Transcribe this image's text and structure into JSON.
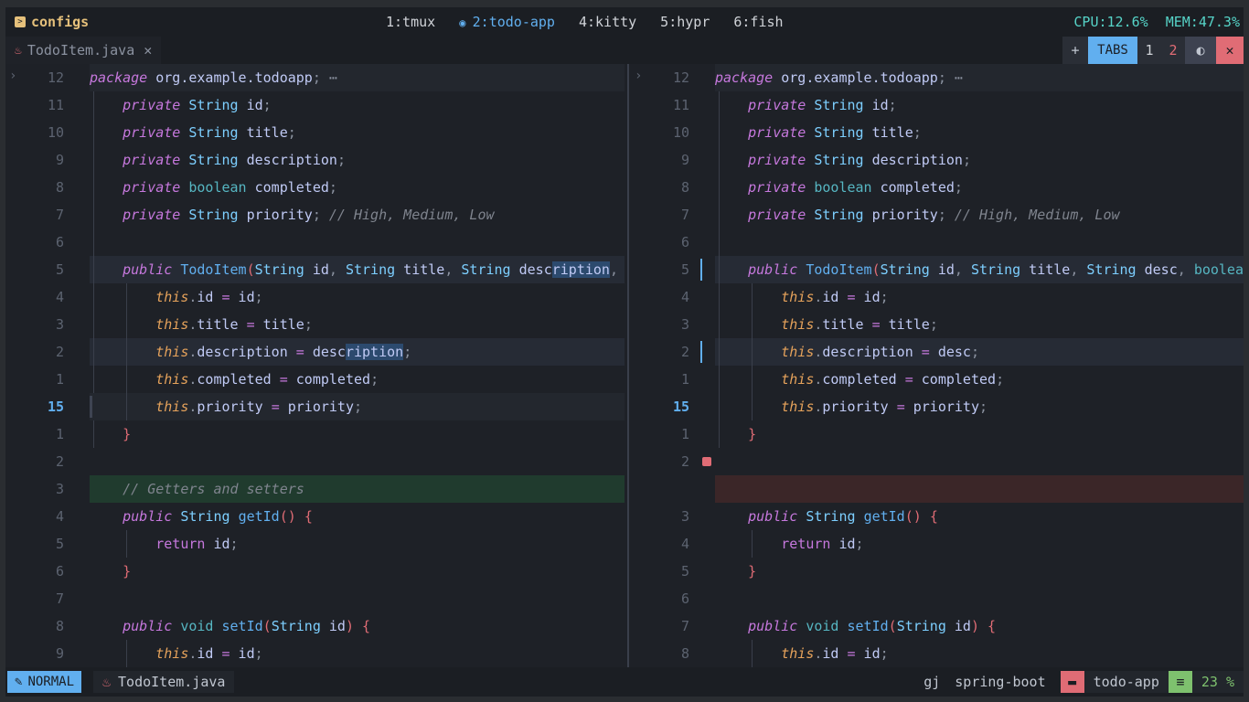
{
  "topbar": {
    "title": "configs",
    "workspaces": [
      "1:tmux",
      "2:todo-app",
      "4:kitty",
      "5:hypr",
      "6:fish"
    ],
    "active_workspace": "2:todo-app",
    "cpu": "CPU:12.6%",
    "mem": "MEM:47.3%"
  },
  "tab": {
    "name": "TodoItem.java",
    "close": "✕"
  },
  "tabctrls": {
    "plus": "+",
    "tabs": "TABS",
    "one": "1",
    "two": "2",
    "toggle": "⏽",
    "close": "✕"
  },
  "left_numbers": [
    "12",
    "11",
    "10",
    "9",
    "8",
    "7",
    "6",
    "5",
    "4",
    "3",
    "2",
    "1",
    "15",
    "1",
    "2",
    "3",
    "4",
    "5",
    "6",
    "7",
    "8",
    "9"
  ],
  "right_numbers": [
    "12",
    "11",
    "10",
    "9",
    "8",
    "7",
    "6",
    "5",
    "4",
    "3",
    "2",
    "1",
    "15",
    "1",
    "2",
    "",
    "3",
    "4",
    "5",
    "6",
    "7",
    "8"
  ],
  "status": {
    "mode": "NORMAL",
    "file": "TodoItem.java",
    "keys": "gj",
    "branch": "spring-boot",
    "project": "todo-app",
    "percent": "23 %"
  },
  "colors": {
    "accent": "#61afef",
    "added": "#203b2e",
    "deleted": "#3b2628",
    "keyword": "#c678dd"
  }
}
